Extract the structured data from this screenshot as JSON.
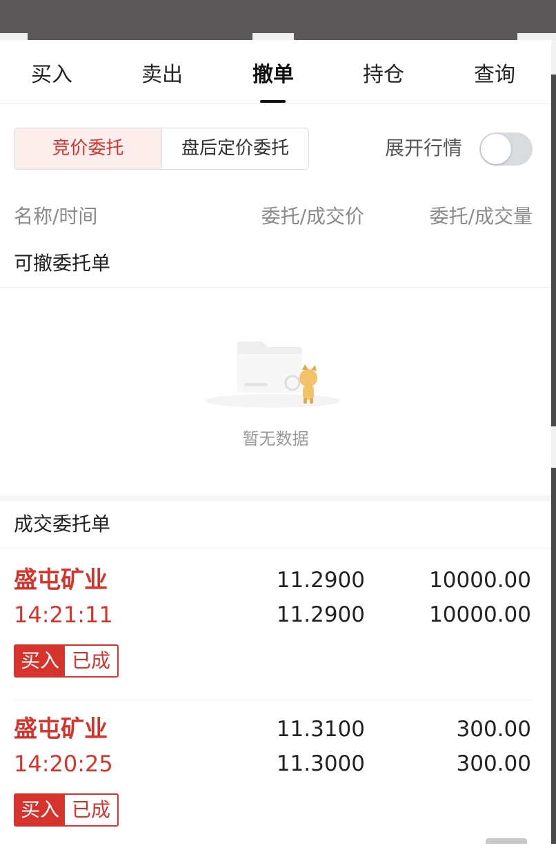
{
  "tabs": [
    {
      "label": "买入"
    },
    {
      "label": "卖出"
    },
    {
      "label": "撤单"
    },
    {
      "label": "持仓"
    },
    {
      "label": "查询"
    }
  ],
  "active_tab_index": 2,
  "segments": {
    "active_label": "竞价委托",
    "inactive_label": "盘后定价委托"
  },
  "expand_quotes": {
    "label": "展开行情",
    "enabled": false
  },
  "columns": {
    "name_time": "名称/时间",
    "price": "委托/成交价",
    "volume": "委托/成交量"
  },
  "cancellable_section": {
    "title": "可撤委托单",
    "empty_text": "暂无数据"
  },
  "filled_section": {
    "title": "成交委托单",
    "orders": [
      {
        "name": "盛屯矿业",
        "time": "14:21:11",
        "order_price": "11.2900",
        "deal_price": "11.2900",
        "order_qty": "10000.00",
        "deal_qty": "10000.00",
        "side": "买入",
        "status": "已成"
      },
      {
        "name": "盛屯矿业",
        "time": "14:20:25",
        "order_price": "11.3100",
        "deal_price": "11.3000",
        "order_qty": "300.00",
        "deal_qty": "300.00",
        "side": "买入",
        "status": "已成"
      }
    ]
  },
  "colors": {
    "accent_red": "#d5332b",
    "toggle_off": "#d9dcde",
    "segment_active_bg": "#fdeeee"
  }
}
